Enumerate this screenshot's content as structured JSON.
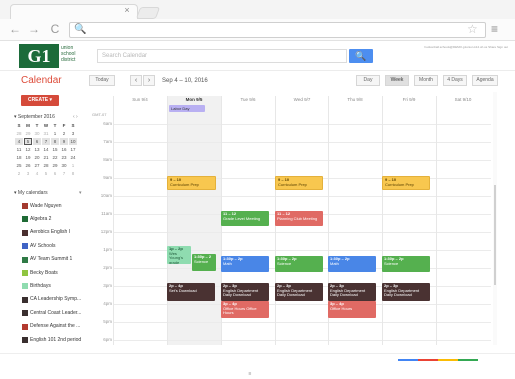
{
  "browser": {
    "tab_close": "×",
    "back": "←",
    "forward": "→",
    "reload": "C",
    "omni_icon": "🔍",
    "star": "☆",
    "menu": "≡",
    "address": ""
  },
  "header": {
    "logo_letters": "G1",
    "logo_text_line1": "union",
    "logo_text_line2": "school",
    "logo_text_line3": "district",
    "search_placeholder": "Search Calendar",
    "search_icon": "🔍",
    "account_text": "hudsonhall.schools@DEMO.g1union.k12.oh.us  Share  Sign out"
  },
  "toolbar": {
    "app_title": "Calendar",
    "today": "Today",
    "prev": "‹",
    "next": "›",
    "date_range": "Sep 4 – 10, 2016",
    "views": [
      "Day",
      "Week",
      "Month",
      "4 Days",
      "Agenda"
    ],
    "active_view": "Week"
  },
  "sidebar": {
    "create": "CREATE ▾",
    "mini_cal": {
      "title": "▾ September 2016",
      "arrows": "‹  ›",
      "day_headers": [
        "S",
        "M",
        "T",
        "W",
        "T",
        "F",
        "S"
      ],
      "weeks": [
        [
          "28",
          "29",
          "30",
          "31",
          "1",
          "2",
          "3"
        ],
        [
          "4",
          "5",
          "6",
          "7",
          "8",
          "9",
          "10"
        ],
        [
          "11",
          "12",
          "13",
          "14",
          "15",
          "16",
          "17"
        ],
        [
          "18",
          "19",
          "20",
          "21",
          "22",
          "23",
          "24"
        ],
        [
          "25",
          "26",
          "27",
          "28",
          "29",
          "30",
          "1"
        ],
        [
          "2",
          "3",
          "4",
          "5",
          "6",
          "7",
          "8"
        ]
      ]
    },
    "my_calendars_title": "▾ My calendars",
    "my_calendars_button": "▾",
    "calendars": [
      {
        "label": "Wade Nguyen",
        "color": "#a33a2f"
      },
      {
        "label": "Algebra 2",
        "color": "#1f6b35"
      },
      {
        "label": "Aerobics English I",
        "color": "#4a2f2f"
      },
      {
        "label": "AV Schools",
        "color": "#3f63c5"
      },
      {
        "label": "AV Team Summit 1",
        "color": "#2f7a45"
      },
      {
        "label": "Becky Boats",
        "color": "#8fc540"
      },
      {
        "label": "Birthdays",
        "color": "#8fdcb0"
      },
      {
        "label": "CA Leadership Symp...",
        "color": "#3a2f2f"
      },
      {
        "label": "Central Coast Leader...",
        "color": "#3a2f2f"
      },
      {
        "label": "Defense Against the ...",
        "color": "#b33a2f"
      },
      {
        "label": "English 101 2nd period",
        "color": "#3a2f2f"
      }
    ]
  },
  "grid": {
    "gmt": "GMT-07",
    "days": [
      "Sun 9/4",
      "Mon 9/5",
      "Tue 9/6",
      "Wed 9/7",
      "Thu 9/8",
      "Fri 9/9",
      "Sat 9/10"
    ],
    "today_index": 1,
    "hours": [
      "6am",
      "7am",
      "8am",
      "9am",
      "10am",
      "11am",
      "12pm",
      "1pm",
      "2pm",
      "3pm",
      "4pm",
      "5pm",
      "6pm"
    ],
    "all_day_event": "Labor Day",
    "events": {
      "tue_curr": {
        "time": "9 – 10",
        "title": "Curriculum Prep"
      },
      "thu_curr": {
        "time": "9 – 10",
        "title": "Curriculum Prep"
      },
      "sat_curr": {
        "time": "9 – 10",
        "title": "Curriculum Prep"
      },
      "wed_grade": {
        "time": "11 – 12",
        "title": "Grade Level Meeting"
      },
      "thu_planning": {
        "time": "11 – 12",
        "title": "Planning Club Meeting"
      },
      "mon_birthday": {
        "time": "1p – 2p",
        "title": "Wes Young's grade"
      },
      "mon_science": {
        "time": "1:30p – 2",
        "title": "Science"
      },
      "wed_math": {
        "time": "1:30p – 2p",
        "title": "Math"
      },
      "thu_science": {
        "time": "1:30p – 2p",
        "title": "Science"
      },
      "fri_math": {
        "time": "1:30p – 2p",
        "title": "Math"
      },
      "sat_science": {
        "time": "1:30p – 2p",
        "title": "Science"
      },
      "tue_planned": {
        "time": "2p – 4p",
        "title": "Set's Download"
      },
      "wed_english": {
        "time": "2p – 3p",
        "title": "English Department Daily Download"
      },
      "thu_english": {
        "time": "2p – 3p",
        "title": "English Department Daily Download"
      },
      "fri_english": {
        "time": "2p – 3p",
        "title": "English Department Daily Download"
      },
      "sat_english": {
        "time": "2p – 3p",
        "title": "English Department Daily Download"
      },
      "wed_office": {
        "time": "3p – 4p",
        "title": "Office Hours Office Hours"
      },
      "fri_office": {
        "time": "3p – 4p",
        "title": "Office Hours"
      }
    }
  },
  "footer": {
    "mark": "≡"
  }
}
